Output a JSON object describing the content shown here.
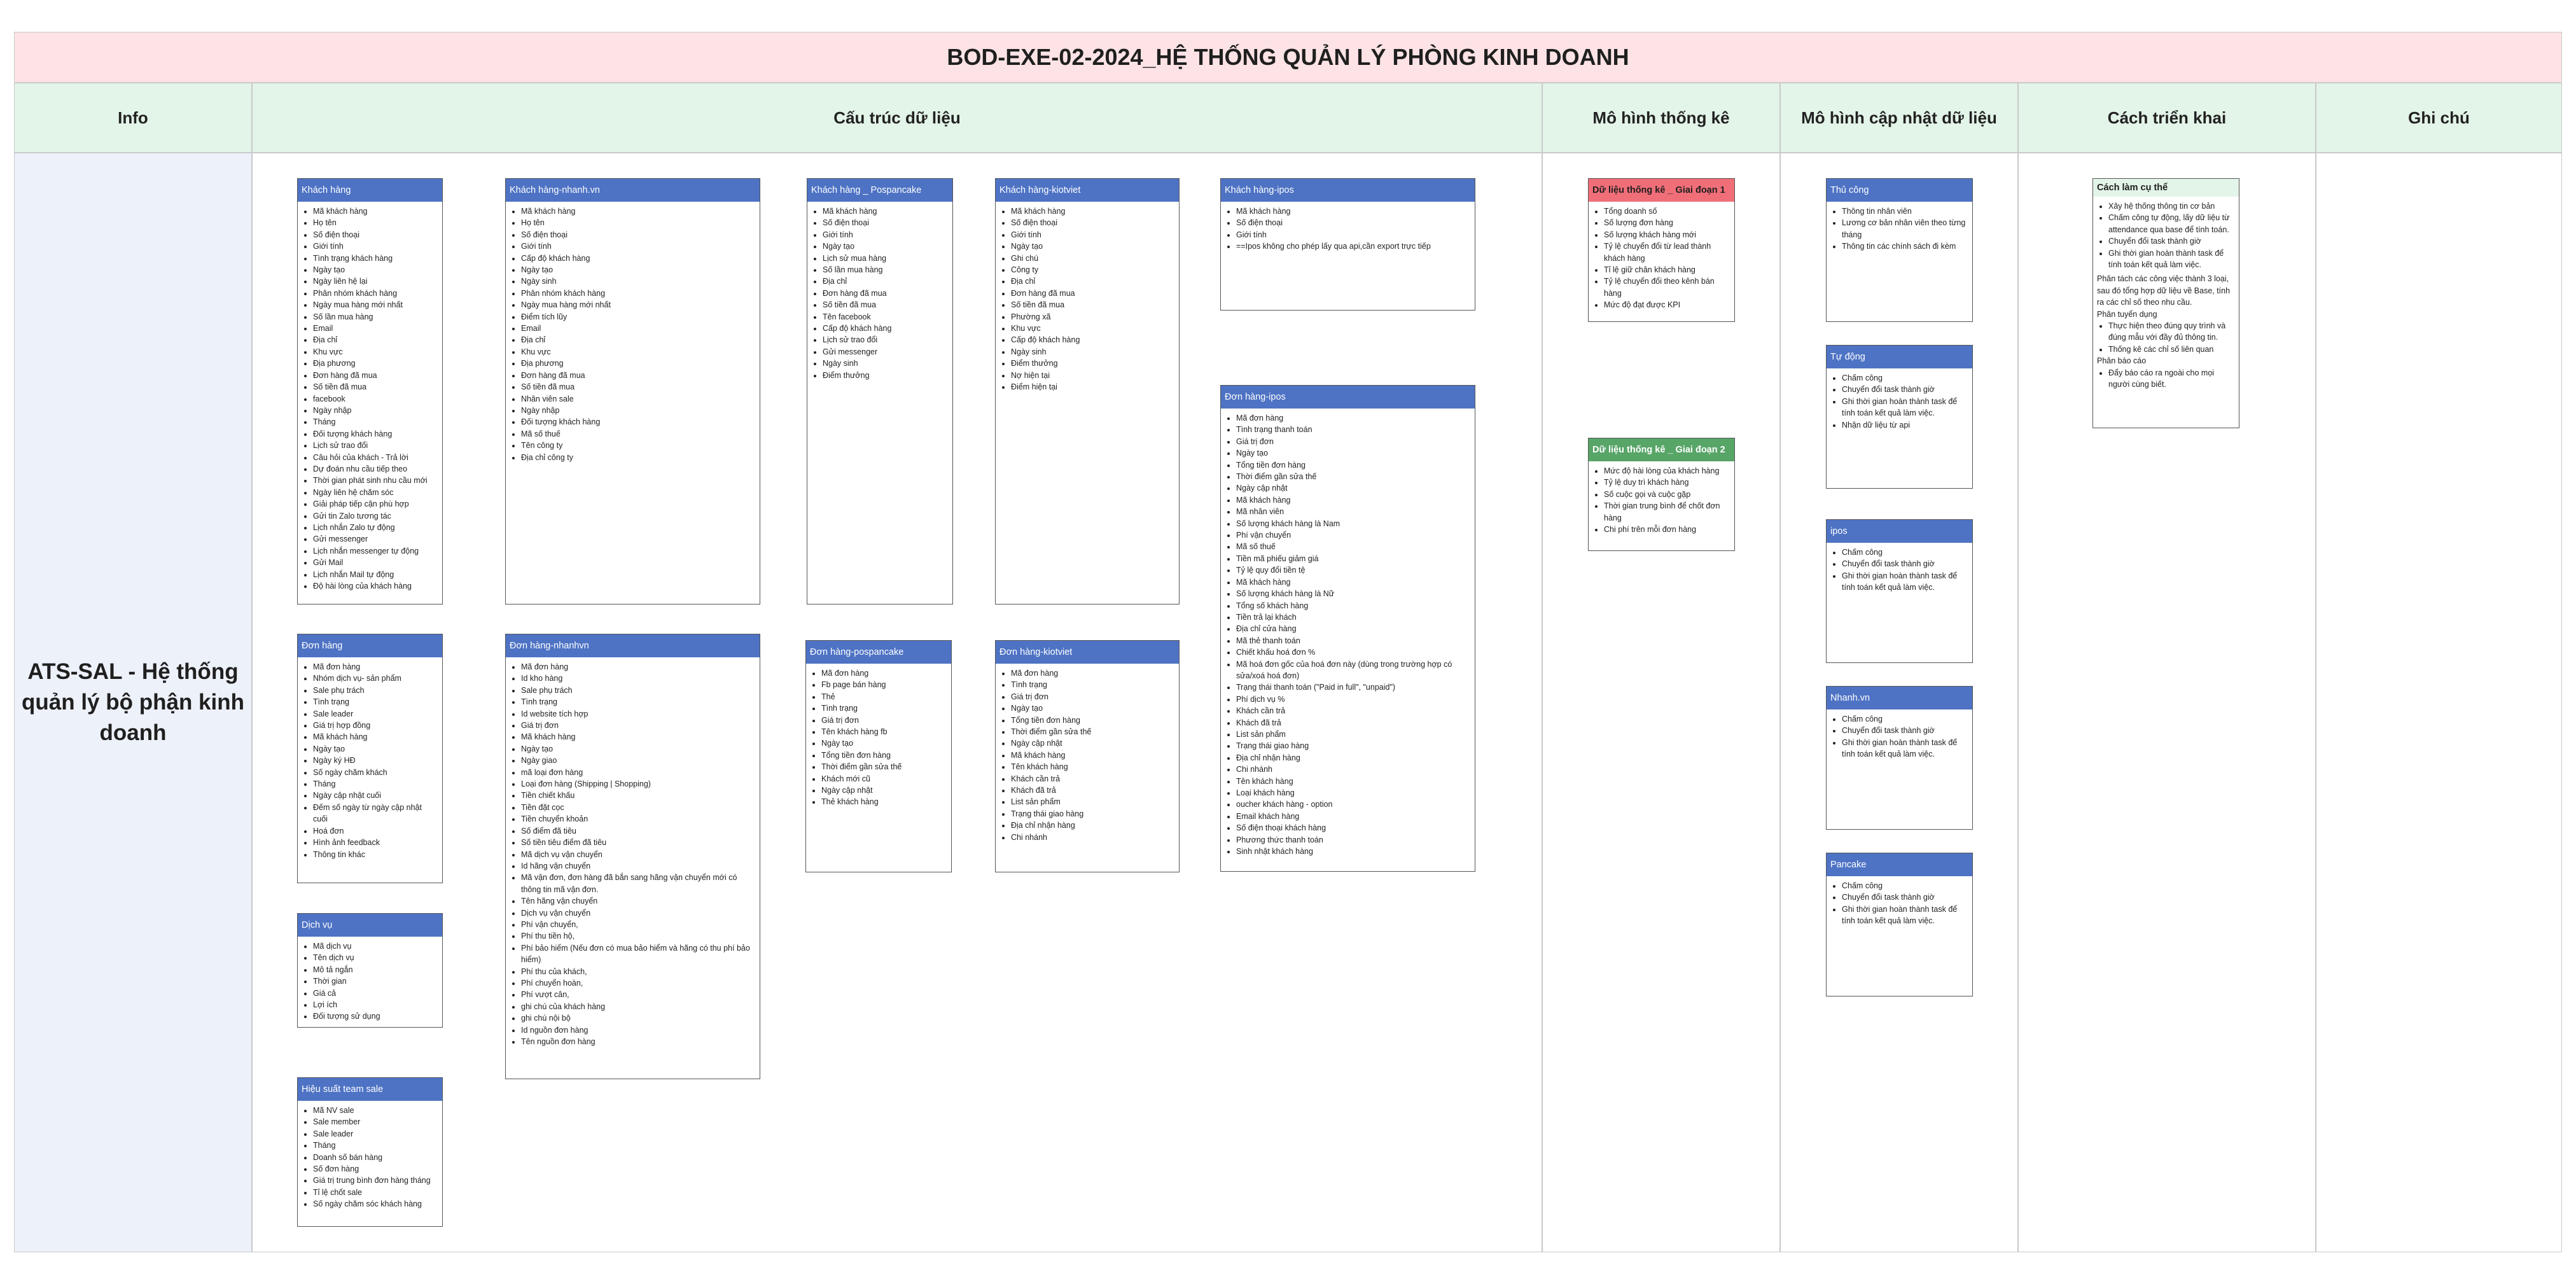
{
  "title": "BOD-EXE-02-2024_HỆ THỐNG QUẢN LÝ PHÒNG KINH DOANH",
  "headers": {
    "info": "Info",
    "data_structure": "Cấu trúc dữ liệu",
    "statistics": "Mô hình thống kê",
    "update_model": "Mô hình cập nhật dữ liệu",
    "deployment": "Cách triển khai",
    "notes": "Ghi chú"
  },
  "info_text": "ATS-SAL - Hệ thống quản lý bộ phận kinh doanh",
  "boxes": {
    "khach_hang": {
      "title": "Khách hàng",
      "items": [
        "Mã khách hàng",
        "Họ tên",
        "Số điện thoại",
        "Giới tính",
        "Tình trạng khách hàng",
        "Ngày tạo",
        "Ngày liên hệ lại",
        "Phân nhóm khách hàng",
        "Ngày mua hàng mới nhất",
        "Số lần mua hàng",
        "Email",
        "Địa chỉ",
        "Khu vực",
        "Địa phương",
        "Đơn hàng đã mua",
        "Số tiền đã mua",
        "facebook",
        "Ngày nhập",
        "Tháng",
        "Đối tượng khách hàng",
        "Lịch sử trao đổi",
        "Câu hỏi của khách - Trả lời",
        "Dự đoán nhu cầu tiếp theo",
        "Thời gian phát sinh nhu cầu mới",
        "Ngày liên hệ chăm sóc",
        "Giải pháp tiếp cận phù hợp",
        "Gửi tin Zalo tương tác",
        "Lịch nhắn Zalo tự động",
        "Gửi messenger",
        "Lịch nhắn messenger tự động",
        "Gửi Mail",
        "Lịch nhắn Mail tự động",
        "Độ hài lòng của khách hàng"
      ]
    },
    "khach_hang_nhanh": {
      "title": "Khách hàng-nhanh.vn",
      "items": [
        "Mã khách hàng",
        "Họ tên",
        "Số điện thoại",
        "Giới tính",
        "Cấp độ khách hàng",
        "Ngày tạo",
        "Ngày sinh",
        "Phân nhóm khách hàng",
        "Ngày mua hàng mới nhất",
        "Điểm tích lũy",
        "Email",
        "Địa chỉ",
        "Khu vực",
        "Địa phương",
        "Đơn hàng đã mua",
        "Số tiền đã mua",
        "Nhân viên sale",
        "Ngày nhập",
        "Đối tượng khách hàng",
        "Mã số thuế",
        "Tên công ty",
        "Địa chỉ công ty"
      ]
    },
    "khach_hang_pospancake": {
      "title": "Khách hàng _ Pospancake",
      "items": [
        "Mã khách hàng",
        "Số điện thoại",
        "Giới tính",
        "Ngày tạo",
        "Lịch sử mua hàng",
        "Số lần mua hàng",
        "Địa chỉ",
        "Đơn hàng đã mua",
        "Số tiền đã mua",
        "Tên facebook",
        "Cấp độ khách hàng",
        "Lịch sử trao đổi",
        "Gửi messenger",
        "Ngày sinh",
        "Điểm thưởng"
      ]
    },
    "khach_hang_kiotviet": {
      "title": "Khách hàng-kiotviet",
      "items": [
        "Mã khách hàng",
        "Số điện thoại",
        "Giới tính",
        "Ngày tạo",
        "Ghi chú",
        "Công ty",
        "Địa chỉ",
        "Đơn hàng đã mua",
        "Số tiền đã mua",
        "Phường xã",
        "Khu vực",
        "Cấp độ khách hàng",
        "Ngày sinh",
        "Điểm thưởng",
        "Nợ hiện tại",
        "Điểm hiện tại"
      ]
    },
    "khach_hang_ipos": {
      "title": "Khách hàng-ipos",
      "items": [
        "Mã khách hàng",
        "Số điện thoại",
        "Giới tính",
        "==Ipos không cho phép lấy qua api,cần export trực tiếp"
      ]
    },
    "don_hang_ipos": {
      "title": "Đơn hàng-ipos",
      "items": [
        "Mã đơn hàng",
        "Tình trạng thanh toán",
        "Giá trị đơn",
        "Ngày tạo",
        "Tổng tiền đơn hàng",
        "Thời điểm gần sửa thế",
        "Ngày cập nhật",
        "Mã khách hàng",
        "Mã nhân viên",
        "Số lượng khách hàng là Nam",
        "Phí vận chuyển",
        "Mã số thuế",
        "Tiền mã phiếu giảm giá",
        "Tỷ lệ quy đổi tiền tệ",
        "Mã khách hàng",
        "Số lượng khách hàng là Nữ",
        "Tổng số khách hàng",
        "Tiền trả lại khách",
        "Địa chỉ cửa hàng",
        "Mã thẻ thanh toán",
        "Chiết khấu hoá đơn %",
        "Mã hoá đơn gốc của hoá đơn này (dùng trong trường hợp có sửa/xoá hoá đơn)",
        "Trạng thái thanh toán (\"Paid in full\", \"unpaid\")",
        "Phí dịch vụ %",
        "Khách cần trả",
        "Khách đã trả",
        "List sản phẩm",
        "Trạng thái giao hàng",
        "Địa chỉ nhận hàng",
        "Chi nhánh",
        "Tên khách hàng",
        "Loại khách hàng",
        "oucher khách hàng - option",
        "Email khách hàng",
        "Số điện thoại khách hàng",
        "Phương thức thanh toán",
        "Sinh nhật khách hàng"
      ]
    },
    "don_hang": {
      "title": "Đơn hàng",
      "items": [
        "Mã đơn hàng",
        "Nhóm dịch vụ- sản phẩm",
        "Sale phụ trách",
        "Tình trạng",
        "Sale leader",
        "Giá trị hợp đồng",
        "Mã khách hàng",
        "Ngày tạo",
        "Ngày ký HĐ",
        "Số ngày chăm khách",
        "Tháng",
        "Ngày cập nhật cuối",
        "Đếm số ngày từ ngày cập nhật cuối",
        "Hoá đơn",
        "Hình ảnh feedback",
        "Thông tin khác"
      ]
    },
    "don_hang_nhanh": {
      "title": "Đơn hàng-nhanhvn",
      "items": [
        "Mã đơn hàng",
        "Id kho hàng",
        "Sale phụ trách",
        "Tình trạng",
        "Id website tích hợp",
        "Giá trị đơn",
        "Mã khách hàng",
        "Ngày tạo",
        "Ngày giao",
        "mã loại đơn hàng",
        "Loại đơn hàng (Shipping | Shopping)",
        "Tiền chiết khấu",
        "Tiền đặt cọc",
        "Tiền chuyển khoản",
        "Số điểm đã tiêu",
        "Số tiền tiêu điểm đã tiêu",
        "Mã dịch vụ vận chuyển",
        "Id hãng vận chuyển",
        "Mã vận đơn, đơn hàng đã bắn sang hãng vận chuyển mới có thông tin mã vận đơn.",
        "Tên hãng vận chuyển",
        "Dịch vụ vận chuyển",
        "Phí vận chuyển,",
        "Phí thu tiền hộ,",
        "Phí bảo hiểm (Nếu đơn có mua bảo hiểm và hãng có thu phí bảo hiểm)",
        "Phí thu của khách,",
        "Phí chuyển hoàn,",
        "Phí vượt cân,",
        "ghi chú của khách hàng",
        "ghi chú nội bộ",
        "Id nguồn đơn hàng",
        "Tên nguồn đơn hàng"
      ]
    },
    "don_hang_pospancake": {
      "title": "Đơn hàng-pospancake",
      "items": [
        "Mã đơn hàng",
        "Fb page bán hàng",
        "Thẻ",
        "Tình trạng",
        "Giá trị đơn",
        "Tên khách hàng fb",
        "Ngày tạo",
        "Tổng tiền đơn hàng",
        "Thời điểm gần sửa thế",
        "Khách mới cũ",
        "Ngày cập nhật",
        "Thẻ khách hàng"
      ]
    },
    "don_hang_kiotviet": {
      "title": "Đơn hàng-kiotviet",
      "items": [
        "Mã đơn hàng",
        "Tình trạng",
        "Giá trị đơn",
        "Ngày tạo",
        "Tổng tiền đơn hàng",
        "Thời điểm gần sửa thế",
        "Ngày cập nhật",
        "Mã khách hàng",
        "Tên khách hàng",
        "Khách cần trả",
        "Khách đã trả",
        "List sản phẩm",
        "Trạng thái giao hàng",
        "Địa chỉ nhận hàng",
        "Chi nhánh"
      ]
    },
    "dich_vu": {
      "title": "Dịch vụ",
      "items": [
        "Mã dịch vụ",
        "Tên dịch vụ",
        "Mô tả ngắn",
        "Thời gian",
        "Giá cả",
        "Lợi ích",
        "Đối tượng sử dụng"
      ]
    },
    "hieu_suat": {
      "title": "Hiệu suất team sale",
      "items": [
        "Mã NV sale",
        "Sale member",
        "Sale leader",
        "Tháng",
        "Doanh số bán hàng",
        "Số đơn hàng",
        "Giá trị trung bình đơn hàng tháng",
        "Tỉ lệ chốt sale",
        "Số ngày chăm sóc khách hàng"
      ]
    },
    "thong_ke_1": {
      "title": "Dữ liệu thống kê _ Giai đoạn 1",
      "items": [
        "Tổng doanh số",
        "Số lượng đơn hàng",
        "Số lượng khách hàng mới",
        "Tỷ lệ chuyển đổi từ lead thành khách hàng",
        "Tỉ lệ giữ chân khách hàng",
        "Tỷ lệ chuyển đổi theo kênh bán hàng",
        "Mức độ đạt được KPI"
      ]
    },
    "thong_ke_2": {
      "title": "Dữ liệu thống kê _ Giai đoạn 2",
      "items": [
        "Mức độ hài lòng của khách hàng",
        "Tỷ lệ duy trì khách hàng",
        "Số cuộc gọi và cuộc gặp",
        "Thời gian trung bình để chốt đơn hàng",
        "Chi phí trên mỗi đơn hàng"
      ]
    },
    "thu_cong": {
      "title": "Thủ công",
      "items": [
        "Thông tin nhân viên",
        "Lương cơ bản nhân viên theo từng tháng",
        "Thông tin các chính sách đi kèm"
      ]
    },
    "tu_dong": {
      "title": "Tự động",
      "items": [
        "Chấm công",
        "Chuyển đổi task thành giờ",
        "Ghi thời gian hoàn thành task để tính toán  kết quả làm việc.",
        "Nhận dữ liệu từ api"
      ]
    },
    "ipos_update": {
      "title": "ipos",
      "items": [
        "Chấm công",
        "Chuyển đổi task thành giờ",
        "Ghi thời gian hoàn thành task để tính toán  kết quả làm việc."
      ]
    },
    "nhanh_update": {
      "title": "Nhanh.vn",
      "items": [
        "Chấm công",
        "Chuyển đổi task thành giờ",
        "Ghi thời gian hoàn thành task để tính toán  kết quả làm việc."
      ]
    },
    "pancake_update": {
      "title": "Pancake",
      "items": [
        "Chấm công",
        "Chuyển đổi task thành giờ",
        "Ghi thời gian hoàn thành task để tính toán  kết quả làm việc."
      ]
    },
    "cach_lam": {
      "title": "Cách làm cụ thể",
      "list1": [
        "Xây hệ thống thông tin cơ bản",
        "Chấm công tự động, lấy dữ liệu từ attendance qua base để tính toán.",
        "Chuyển đổi task thành giờ",
        "Ghi thời gian hoàn thành task để tính toán  kết quả làm việc."
      ],
      "para1": "Phân tách các công việc thành 3 loại, sau đó tổng hợp dữ liệu về Base, tính ra các chỉ số theo nhu cầu.",
      "para2": "Phân tuyển dụng",
      "list2": [
        "Thực hiện theo đúng quy trình và đúng mẫu với đầy đủ thông tin.",
        "Thống kê các chỉ số liên quan"
      ],
      "para3": "Phân báo cáo",
      "list3": [
        "Đẩy báo cáo ra ngoài cho mọi người cùng biết."
      ]
    }
  }
}
